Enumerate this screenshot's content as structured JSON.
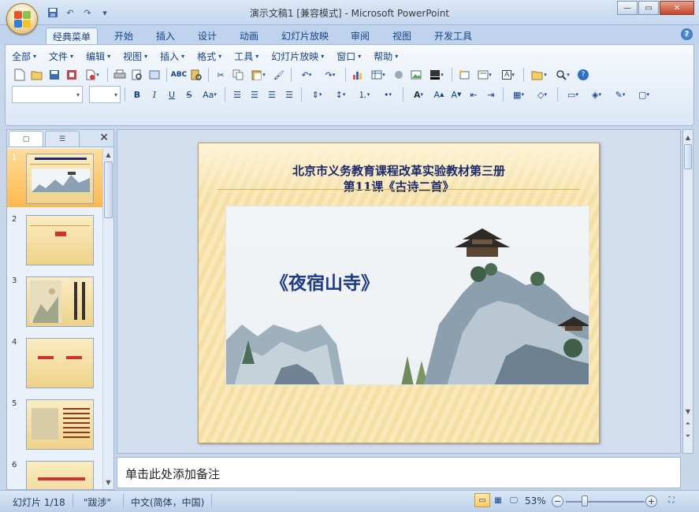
{
  "window": {
    "title": "演示文稿1 [兼容模式] - Microsoft PowerPoint",
    "controls": [
      "minimize",
      "maximize",
      "close"
    ]
  },
  "quick_access": [
    "save-icon",
    "undo-icon",
    "redo-icon",
    "customize-icon"
  ],
  "ribbon_tabs": [
    "经典菜单",
    "开始",
    "插入",
    "设计",
    "动画",
    "幻灯片放映",
    "审阅",
    "视图",
    "开发工具"
  ],
  "active_tab": "经典菜单",
  "classic_menu": [
    "全部",
    "文件",
    "编辑",
    "视图",
    "插入",
    "格式",
    "工具",
    "幻灯片放映",
    "窗口",
    "帮助"
  ],
  "slides": [
    {
      "num": "1",
      "selected": true
    },
    {
      "num": "2",
      "selected": false
    },
    {
      "num": "3",
      "selected": false
    },
    {
      "num": "4",
      "selected": false
    },
    {
      "num": "5",
      "selected": false
    },
    {
      "num": "6",
      "selected": false
    }
  ],
  "current_slide": {
    "title_line1": "北京市义务教育课程改革实验教材第三册",
    "title_line2": "第11课《古诗二首》",
    "poem_title": "《夜宿山寺》"
  },
  "notes": {
    "placeholder": "单击此处添加备注"
  },
  "status": {
    "slide_counter": "幻灯片 1/18",
    "theme": "\"跋涉\"",
    "language": "中文(简体，中国)",
    "zoom": "53%"
  },
  "colors": {
    "ribbon_bg": "#dde8f6",
    "selected_thumb": "#ffb84d",
    "slide_title": "#1a2a6c",
    "poem_title": "#1e3a8a",
    "slide_bg": "#f5dfa5"
  }
}
